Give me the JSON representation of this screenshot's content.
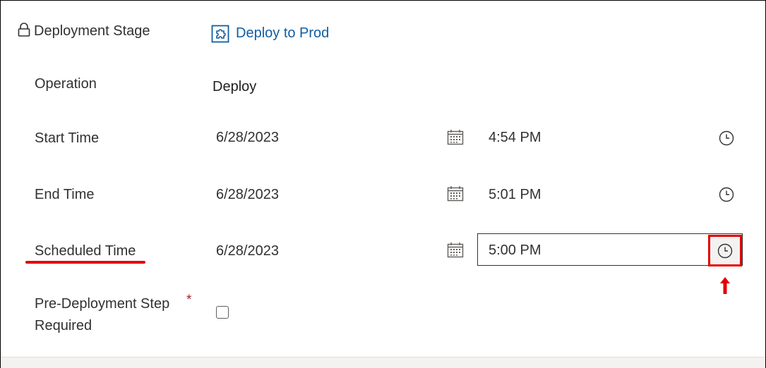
{
  "stage": {
    "label": "Deployment Stage",
    "value": "Deploy to Prod"
  },
  "operation": {
    "label": "Operation",
    "value": "Deploy"
  },
  "start": {
    "label": "Start Time",
    "date": "6/28/2023",
    "time": "4:54 PM"
  },
  "end": {
    "label": "End Time",
    "date": "6/28/2023",
    "time": "5:01 PM"
  },
  "scheduled": {
    "label": "Scheduled Time",
    "date": "6/28/2023",
    "time": "5:00 PM"
  },
  "pre_step": {
    "label_line1": "Pre-Deployment Step",
    "label_line2": "Required",
    "required_mark": "*",
    "checked": false
  },
  "colors": {
    "annotation": "#e50000",
    "link": "#115ea3"
  }
}
